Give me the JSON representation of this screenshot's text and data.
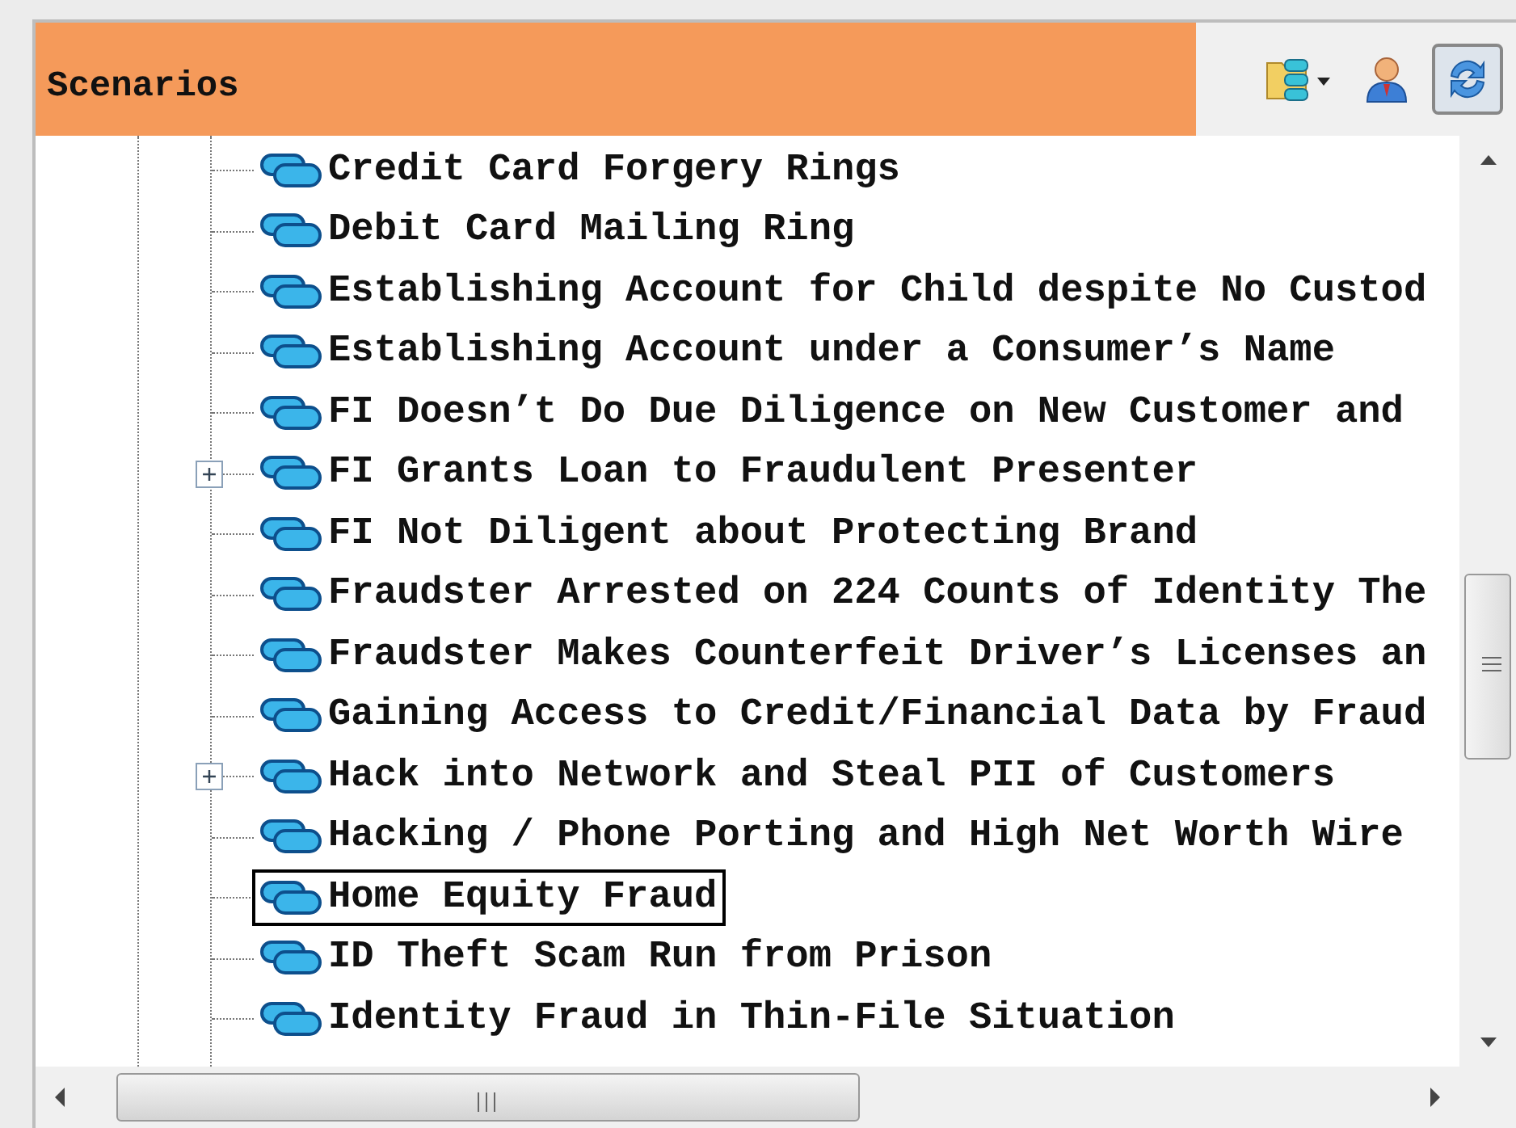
{
  "panel": {
    "title": "Scenarios"
  },
  "toolbar": [
    {
      "kind": "folder",
      "pressed": false
    },
    {
      "kind": "user",
      "pressed": false
    },
    {
      "kind": "refresh",
      "pressed": true
    }
  ],
  "tree": {
    "items": [
      {
        "label": "Credit Card Forgery Rings",
        "has_children": false,
        "selected": false
      },
      {
        "label": "Debit Card Mailing Ring",
        "has_children": false,
        "selected": false
      },
      {
        "label": "Establishing Account for Child despite No Custod",
        "has_children": false,
        "selected": false
      },
      {
        "label": "Establishing Account under a Consumer’s Name",
        "has_children": false,
        "selected": false
      },
      {
        "label": "FI Doesn’t Do Due Diligence on New Customer and",
        "has_children": false,
        "selected": false
      },
      {
        "label": "FI Grants Loan to Fraudulent Presenter",
        "has_children": true,
        "selected": false
      },
      {
        "label": "FI Not Diligent about Protecting Brand",
        "has_children": false,
        "selected": false
      },
      {
        "label": "Fraudster Arrested on 224 Counts of Identity The",
        "has_children": false,
        "selected": false
      },
      {
        "label": "Fraudster Makes Counterfeit Driver’s Licenses an",
        "has_children": false,
        "selected": false
      },
      {
        "label": "Gaining Access to Credit/Financial Data by Fraud",
        "has_children": false,
        "selected": false
      },
      {
        "label": "Hack into Network and Steal PII of Customers",
        "has_children": true,
        "selected": false
      },
      {
        "label": "Hacking / Phone Porting and High Net Worth Wire",
        "has_children": false,
        "selected": false
      },
      {
        "label": "Home Equity Fraud",
        "has_children": false,
        "selected": true
      },
      {
        "label": "ID Theft Scam Run from Prison",
        "has_children": false,
        "selected": false
      },
      {
        "label": "Identity Fraud in Thin-File Situation",
        "has_children": false,
        "selected": false
      }
    ]
  }
}
